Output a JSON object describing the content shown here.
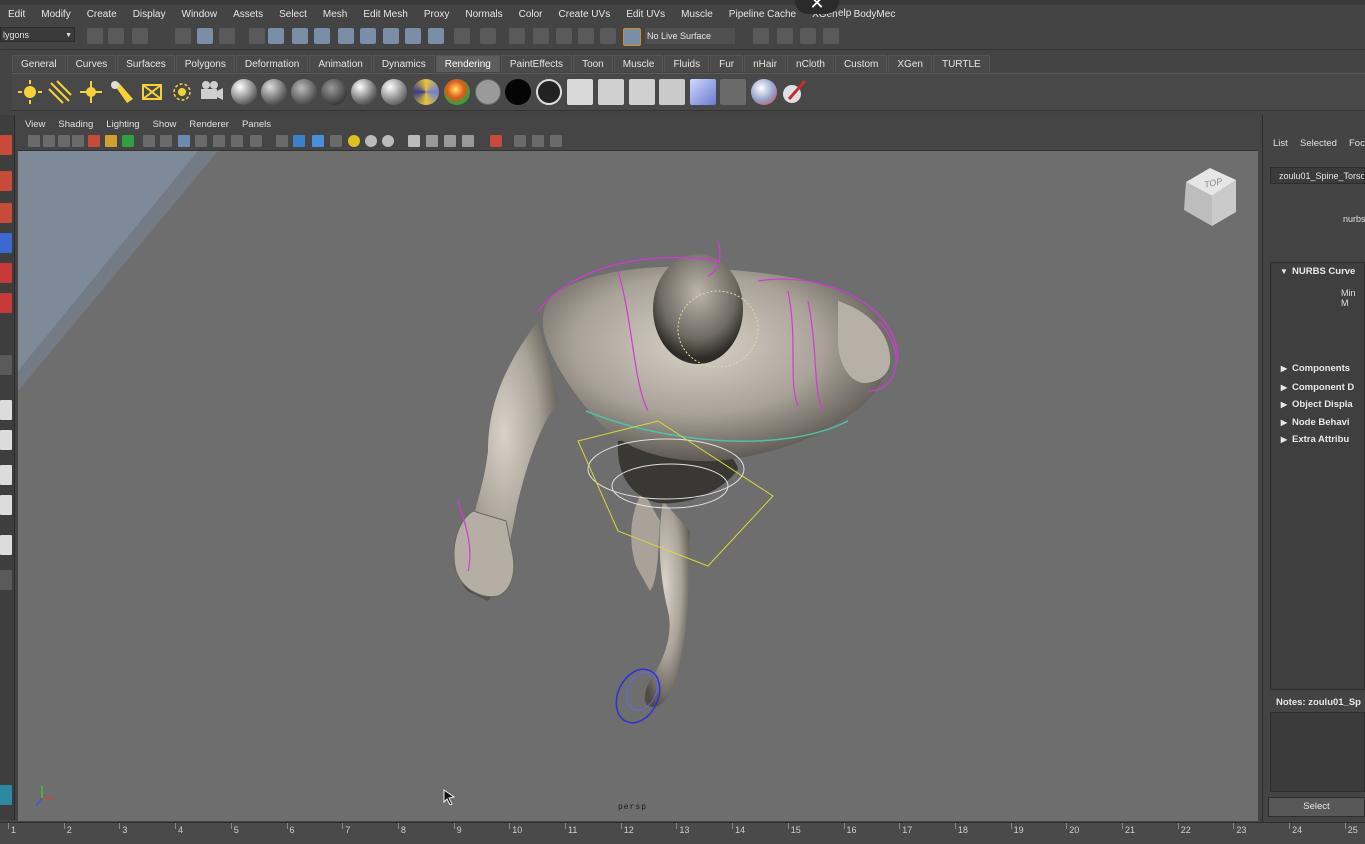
{
  "menubar": {
    "items": [
      "Edit",
      "Modify",
      "Create",
      "Display",
      "Window",
      "Assets",
      "Select",
      "Mesh",
      "Edit Mesh",
      "Proxy",
      "Normals",
      "Color",
      "Create UVs",
      "Edit UVs",
      "Muscle",
      "Pipeline Cache",
      "XGen",
      "BodyMec"
    ],
    "close_symbol": "✕",
    "trailing": "elp"
  },
  "status_line": {
    "mode": "lygons",
    "live_surface": "No Live Surface"
  },
  "shelf": {
    "tabs": [
      "General",
      "Curves",
      "Surfaces",
      "Polygons",
      "Deformation",
      "Animation",
      "Dynamics",
      "Rendering",
      "PaintEffects",
      "Toon",
      "Muscle",
      "Fluids",
      "Fur",
      "nHair",
      "nCloth",
      "Custom",
      "XGen",
      "TURTLE"
    ],
    "active_tab": "Rendering"
  },
  "panel": {
    "menus": [
      "View",
      "Shading",
      "Lighting",
      "Show",
      "Renderer",
      "Panels"
    ],
    "camera_label": "persp",
    "viewcube_label": "TOP"
  },
  "channel_box": {
    "tabs": [
      "List",
      "Selected",
      "Focu"
    ],
    "object_name": "zoulu01_Spine_Torso",
    "shape_label": "nurbs",
    "sections": [
      {
        "label": "NURBS Curve",
        "expanded": true
      },
      {
        "label": "Components",
        "expanded": false
      },
      {
        "label": "Component D",
        "expanded": false
      },
      {
        "label": "Object Displa",
        "expanded": false
      },
      {
        "label": "Node Behavi",
        "expanded": false
      },
      {
        "label": "Extra Attribu",
        "expanded": false
      }
    ],
    "min_label": "Min M",
    "notes_label": "Notes:  zoulu01_Sp",
    "select_button": "Select"
  },
  "timeline": {
    "ticks": [
      "1",
      "2",
      "3",
      "4",
      "5",
      "6",
      "7",
      "8",
      "9",
      "10",
      "11",
      "12",
      "13",
      "14",
      "15",
      "16",
      "17",
      "18",
      "19",
      "20",
      "21",
      "22",
      "23",
      "24",
      "25"
    ]
  }
}
